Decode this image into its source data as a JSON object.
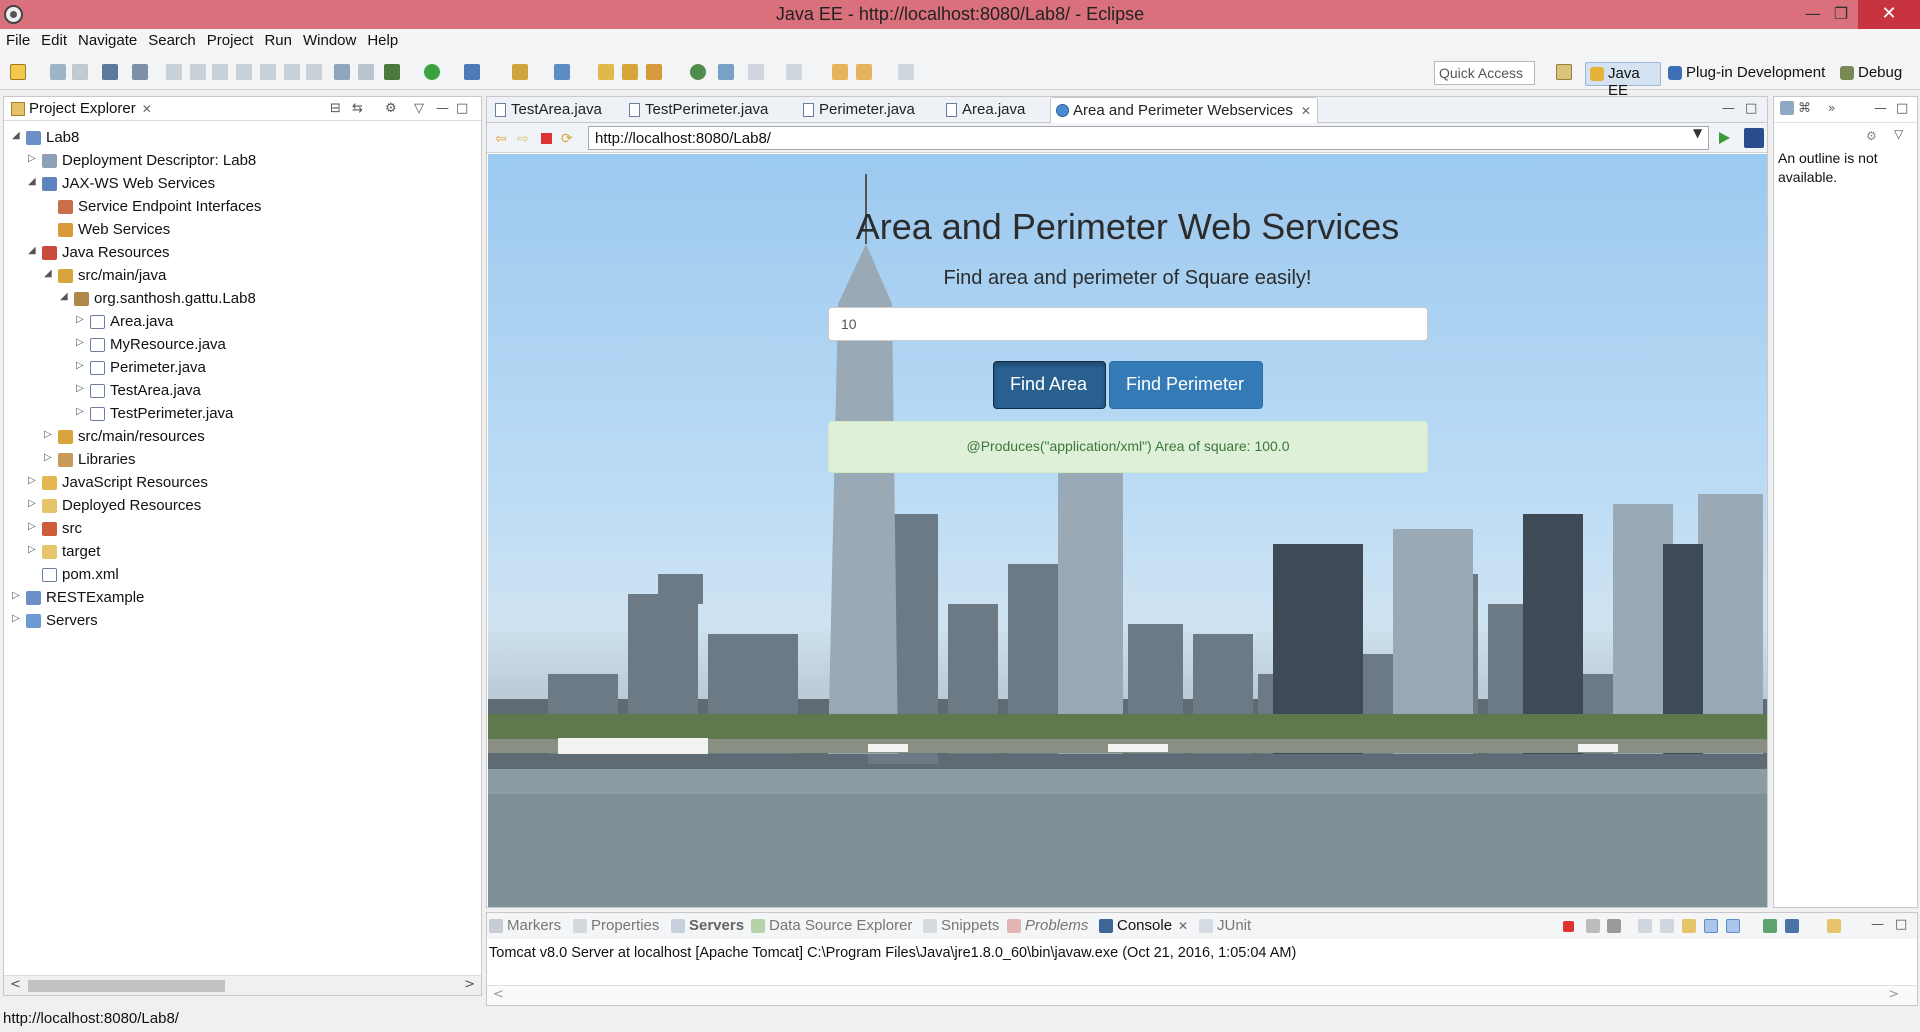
{
  "window": {
    "title": "Java EE - http://localhost:8080/Lab8/ - Eclipse",
    "controls": {
      "minimize": "—",
      "maximize": "❐",
      "close": "✕"
    }
  },
  "menu": [
    "File",
    "Edit",
    "Navigate",
    "Search",
    "Project",
    "Run",
    "Window",
    "Help"
  ],
  "toolbar": {
    "quick_access_placeholder": "Quick Access",
    "perspectives": [
      "Java EE",
      "Plug-in Development",
      "Debug"
    ]
  },
  "project_explorer": {
    "title": "Project Explorer",
    "tree": [
      {
        "label": "Lab8",
        "level": 0,
        "twisty": "◢",
        "icon": "project-icon"
      },
      {
        "label": "Deployment Descriptor: Lab8",
        "level": 1,
        "twisty": "▷",
        "icon": "descriptor-icon"
      },
      {
        "label": "JAX-WS Web Services",
        "level": 1,
        "twisty": "◢",
        "icon": "webservices-icon"
      },
      {
        "label": "Service Endpoint Interfaces",
        "level": 2,
        "twisty": "",
        "icon": "interface-icon"
      },
      {
        "label": "Web Services",
        "level": 2,
        "twisty": "",
        "icon": "webservice-icon"
      },
      {
        "label": "Java Resources",
        "level": 1,
        "twisty": "◢",
        "icon": "java-resources-icon"
      },
      {
        "label": "src/main/java",
        "level": 2,
        "twisty": "◢",
        "icon": "source-folder-icon"
      },
      {
        "label": "org.santhosh.gattu.Lab8",
        "level": 3,
        "twisty": "◢",
        "icon": "package-icon"
      },
      {
        "label": "Area.java",
        "level": 4,
        "twisty": "▷",
        "icon": "java-file-icon"
      },
      {
        "label": "MyResource.java",
        "level": 4,
        "twisty": "▷",
        "icon": "java-file-icon"
      },
      {
        "label": "Perimeter.java",
        "level": 4,
        "twisty": "▷",
        "icon": "java-file-icon"
      },
      {
        "label": "TestArea.java",
        "level": 4,
        "twisty": "▷",
        "icon": "java-file-icon"
      },
      {
        "label": "TestPerimeter.java",
        "level": 4,
        "twisty": "▷",
        "icon": "java-file-icon"
      },
      {
        "label": "src/main/resources",
        "level": 2,
        "twisty": "▷",
        "icon": "source-folder-icon"
      },
      {
        "label": "Libraries",
        "level": 2,
        "twisty": "▷",
        "icon": "library-icon"
      },
      {
        "label": "JavaScript Resources",
        "level": 1,
        "twisty": "▷",
        "icon": "js-resources-icon"
      },
      {
        "label": "Deployed Resources",
        "level": 1,
        "twisty": "▷",
        "icon": "folder-icon"
      },
      {
        "label": "src",
        "level": 1,
        "twisty": "▷",
        "icon": "src-folder-icon"
      },
      {
        "label": "target",
        "level": 1,
        "twisty": "▷",
        "icon": "folder-icon"
      },
      {
        "label": "pom.xml",
        "level": 1,
        "twisty": "",
        "icon": "xml-file-icon"
      },
      {
        "label": "RESTExample",
        "level": 0,
        "twisty": "▷",
        "icon": "project-icon"
      },
      {
        "label": "Servers",
        "level": 0,
        "twisty": "▷",
        "icon": "servers-folder-icon"
      }
    ]
  },
  "editor": {
    "tabs": [
      {
        "label": "TestArea.java",
        "active": false
      },
      {
        "label": "TestPerimeter.java",
        "active": false
      },
      {
        "label": "Perimeter.java",
        "active": false
      },
      {
        "label": "Area.java",
        "active": false
      },
      {
        "label": "Area and Perimeter Webservices",
        "active": true
      }
    ],
    "url": "http://localhost:8080/Lab8/"
  },
  "webpage": {
    "title": "Area and Perimeter Web Services",
    "subtitle": "Find area and perimeter of Square easily!",
    "input_value": "10",
    "find_area_label": "Find Area",
    "find_perimeter_label": "Find Perimeter",
    "result": "@Produces(\"application/xml\") Area of square: 100.0"
  },
  "outline": {
    "message": "An outline is not available."
  },
  "console": {
    "tabs": [
      "Markers",
      "Properties",
      "Servers",
      "Data Source Explorer",
      "Snippets",
      "Problems",
      "Console",
      "JUnit"
    ],
    "active_tab": "Console",
    "text": "Tomcat v8.0 Server at localhost [Apache Tomcat] C:\\Program Files\\Java\\jre1.8.0_60\\bin\\javaw.exe (Oct 21, 2016, 1:05:04 AM)"
  },
  "status_bar": {
    "text": "http://localhost:8080/Lab8/"
  },
  "colors": {
    "title_bar": "#d9707c",
    "close_button": "#c7333f",
    "primary_button": "#337ab7",
    "success_alert": "#dff0d8",
    "success_text": "#3c763d"
  }
}
